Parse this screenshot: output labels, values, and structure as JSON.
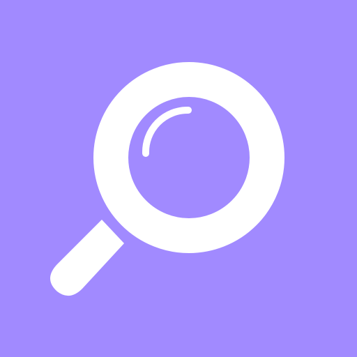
{
  "icon": {
    "name": "magnifying-glass-icon",
    "background_color": "#A18AFF",
    "foreground_color": "#FFFFFF"
  }
}
